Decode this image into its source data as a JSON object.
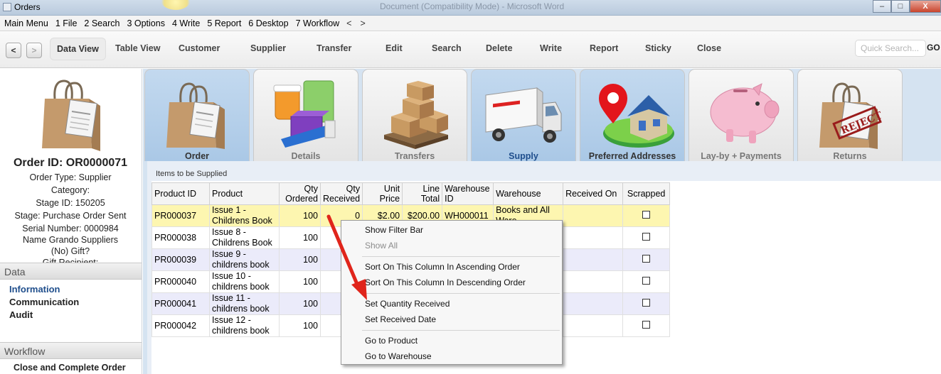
{
  "window": {
    "title": "Orders",
    "caption": "Document (Compatibility Mode) - Microsoft Word",
    "min_label": "–",
    "max_label": "□",
    "close_label": "X"
  },
  "menubar": {
    "items": [
      "Main Menu",
      "1 File",
      "2 Search",
      "3 Options",
      "4 Write",
      "5 Report",
      "6 Desktop",
      "7 Workflow"
    ],
    "scroll_left": "<",
    "scroll_right": ">"
  },
  "toolbar": {
    "back": "<",
    "forward": ">",
    "items": [
      "Data View",
      "Table View",
      "Customer",
      "Supplier",
      "Transfer",
      "Edit",
      "Search",
      "Delete",
      "Write",
      "Report",
      "Sticky",
      "Close"
    ],
    "quick_search_placeholder": "Quick Search...",
    "go": "GO"
  },
  "left": {
    "order_id": "Order ID: OR0000071",
    "lines": [
      "Order Type: Supplier",
      "Category:",
      "Stage ID: 150205",
      "Stage: Purchase Order Sent",
      "Serial Number: 0000984",
      "Name Grando Suppliers",
      "(No) Gift?",
      "Gift Recipient:"
    ],
    "data_header": "Data",
    "data_links": [
      "Information",
      "Communication",
      "Audit"
    ],
    "workflow_header": "Workflow",
    "workflow_links": [
      "Close and Complete Order"
    ]
  },
  "tabs": [
    "Order",
    "Details",
    "Transfers",
    "Supply",
    "Preferred Addresses",
    "Lay-by + Payments",
    "Returns"
  ],
  "grid": {
    "caption": "Items to be Supplied",
    "headers": {
      "product_id": "Product ID",
      "product": "Product",
      "qty_ordered_1": "Qty",
      "qty_ordered_2": "Ordered",
      "qty_received_1": "Qty",
      "qty_received_2": "Received",
      "unit_price_1": "Unit",
      "unit_price_2": "Price",
      "line_total_1": "Line",
      "line_total_2": "Total",
      "warehouse_id_1": "Warehouse",
      "warehouse_id_2": "ID",
      "warehouse": "Warehouse",
      "received_on": "Received On",
      "scrapped": "Scrapped"
    },
    "rows": [
      {
        "id": "PR000037",
        "p1": "Issue 1 -",
        "p2": "Childrens Book",
        "ordered": "100",
        "received": "0",
        "price": "$2.00",
        "total": "$200.00",
        "wid": "WH000011",
        "w1": "Books and All",
        "w2": "Ware"
      },
      {
        "id": "PR000038",
        "p1": "Issue 8 -",
        "p2": "Childrens Book",
        "ordered": "100",
        "received": "",
        "price": "",
        "total": "",
        "wid": "",
        "w1": "",
        "w2": ""
      },
      {
        "id": "PR000039",
        "p1": "Issue 9 -",
        "p2": "childrens book",
        "ordered": "100",
        "received": "",
        "price": "",
        "total": "",
        "wid": "",
        "w1": "",
        "w2": ""
      },
      {
        "id": "PR000040",
        "p1": "Issue 10 -",
        "p2": "childrens book",
        "ordered": "100",
        "received": "",
        "price": "",
        "total": "",
        "wid": "",
        "w1": "",
        "w2": ""
      },
      {
        "id": "PR000041",
        "p1": "Issue 11 -",
        "p2": "childrens book",
        "ordered": "100",
        "received": "",
        "price": "",
        "total": "",
        "wid": "",
        "w1": "",
        "w2": ""
      },
      {
        "id": "PR000042",
        "p1": "Issue 12 -",
        "p2": "childrens book",
        "ordered": "100",
        "received": "",
        "price": "",
        "total": "",
        "wid": "",
        "w1": "",
        "w2": ""
      }
    ]
  },
  "context_menu": {
    "items": [
      {
        "label": "Show Filter Bar",
        "enabled": true
      },
      {
        "label": "Show All",
        "enabled": false
      },
      {
        "label": "Sort On This Column In Ascending Order",
        "enabled": true
      },
      {
        "label": "Sort On This Column In Descending Order",
        "enabled": true
      },
      {
        "label": "Set Quantity Received",
        "enabled": true
      },
      {
        "label": "Set Received Date",
        "enabled": true
      },
      {
        "label": "Go to Product",
        "enabled": true
      },
      {
        "label": "Go to Warehouse",
        "enabled": true
      }
    ]
  },
  "colors": {
    "annotation_arrow": "#e0251b",
    "selected_row": "#fdf6b0",
    "alt_row": "#ebebfa",
    "tabs_background": "#d5e3f1",
    "link_selected": "#1f4e8c"
  }
}
